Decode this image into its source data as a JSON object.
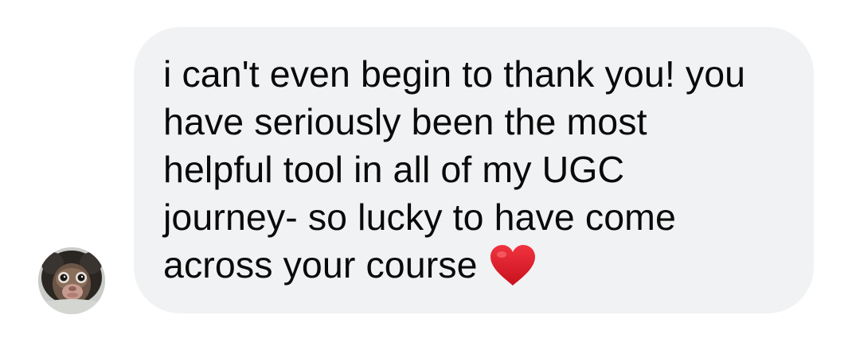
{
  "message": {
    "lines": [
      "i can't even begin to thank you! you",
      "have seriously been the most",
      "helpful tool in all of my UGC",
      "journey- so lucky to have come",
      "across your course"
    ],
    "emoji": "heart-icon"
  },
  "avatar": {
    "icon": "monkey-avatar"
  },
  "colors": {
    "bubble": "#f1f2f4",
    "text": "#0a0a0a",
    "heart": "#e1222f",
    "background": "#ffffff"
  }
}
